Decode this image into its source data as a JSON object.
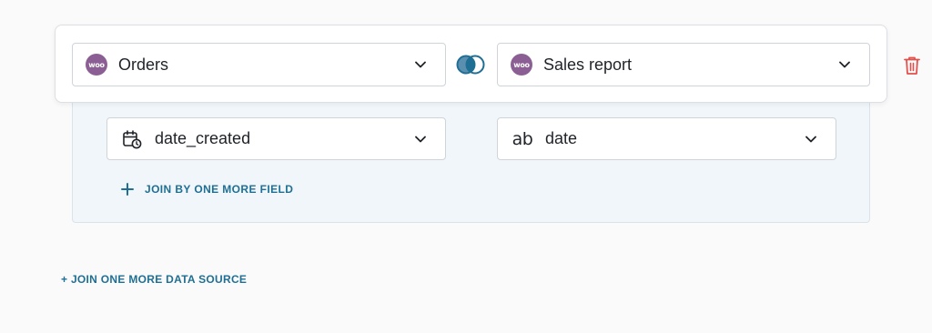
{
  "join": {
    "left_source": {
      "label": "Orders",
      "icon": "woocommerce-icon",
      "icon_text": "woo"
    },
    "right_source": {
      "label": "Sales report",
      "icon": "woocommerce-icon",
      "icon_text": "woo"
    },
    "join_type_icon": "venn-join-icon",
    "delete_icon": "trash-icon",
    "left_field": {
      "label": "date_created",
      "icon": "calendar-clock-icon"
    },
    "right_field": {
      "label": "date",
      "icon": "text-type-icon",
      "icon_text": "ab"
    },
    "add_field_label": "JOIN BY ONE MORE FIELD"
  },
  "add_source_label": "+ JOIN ONE MORE DATA SOURCE",
  "colors": {
    "accent": "#1f6f94",
    "woo_purple": "#8c5f94",
    "delete_red": "#e2504c",
    "panel_bg": "#f1f6fa"
  }
}
